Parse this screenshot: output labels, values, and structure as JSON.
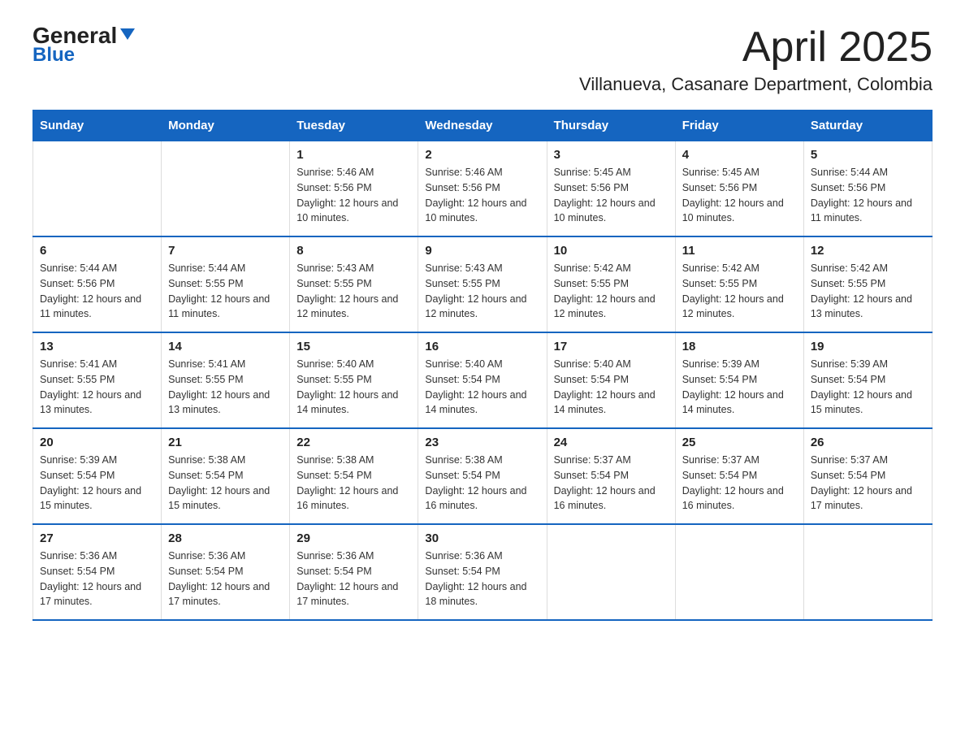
{
  "logo": {
    "general": "General",
    "blue": "Blue"
  },
  "header": {
    "title": "April 2025",
    "subtitle": "Villanueva, Casanare Department, Colombia"
  },
  "weekdays": [
    "Sunday",
    "Monday",
    "Tuesday",
    "Wednesday",
    "Thursday",
    "Friday",
    "Saturday"
  ],
  "weeks": [
    [
      {
        "day": "",
        "info": ""
      },
      {
        "day": "",
        "info": ""
      },
      {
        "day": "1",
        "info": "Sunrise: 5:46 AM\nSunset: 5:56 PM\nDaylight: 12 hours and 10 minutes."
      },
      {
        "day": "2",
        "info": "Sunrise: 5:46 AM\nSunset: 5:56 PM\nDaylight: 12 hours and 10 minutes."
      },
      {
        "day": "3",
        "info": "Sunrise: 5:45 AM\nSunset: 5:56 PM\nDaylight: 12 hours and 10 minutes."
      },
      {
        "day": "4",
        "info": "Sunrise: 5:45 AM\nSunset: 5:56 PM\nDaylight: 12 hours and 10 minutes."
      },
      {
        "day": "5",
        "info": "Sunrise: 5:44 AM\nSunset: 5:56 PM\nDaylight: 12 hours and 11 minutes."
      }
    ],
    [
      {
        "day": "6",
        "info": "Sunrise: 5:44 AM\nSunset: 5:56 PM\nDaylight: 12 hours and 11 minutes."
      },
      {
        "day": "7",
        "info": "Sunrise: 5:44 AM\nSunset: 5:55 PM\nDaylight: 12 hours and 11 minutes."
      },
      {
        "day": "8",
        "info": "Sunrise: 5:43 AM\nSunset: 5:55 PM\nDaylight: 12 hours and 12 minutes."
      },
      {
        "day": "9",
        "info": "Sunrise: 5:43 AM\nSunset: 5:55 PM\nDaylight: 12 hours and 12 minutes."
      },
      {
        "day": "10",
        "info": "Sunrise: 5:42 AM\nSunset: 5:55 PM\nDaylight: 12 hours and 12 minutes."
      },
      {
        "day": "11",
        "info": "Sunrise: 5:42 AM\nSunset: 5:55 PM\nDaylight: 12 hours and 12 minutes."
      },
      {
        "day": "12",
        "info": "Sunrise: 5:42 AM\nSunset: 5:55 PM\nDaylight: 12 hours and 13 minutes."
      }
    ],
    [
      {
        "day": "13",
        "info": "Sunrise: 5:41 AM\nSunset: 5:55 PM\nDaylight: 12 hours and 13 minutes."
      },
      {
        "day": "14",
        "info": "Sunrise: 5:41 AM\nSunset: 5:55 PM\nDaylight: 12 hours and 13 minutes."
      },
      {
        "day": "15",
        "info": "Sunrise: 5:40 AM\nSunset: 5:55 PM\nDaylight: 12 hours and 14 minutes."
      },
      {
        "day": "16",
        "info": "Sunrise: 5:40 AM\nSunset: 5:54 PM\nDaylight: 12 hours and 14 minutes."
      },
      {
        "day": "17",
        "info": "Sunrise: 5:40 AM\nSunset: 5:54 PM\nDaylight: 12 hours and 14 minutes."
      },
      {
        "day": "18",
        "info": "Sunrise: 5:39 AM\nSunset: 5:54 PM\nDaylight: 12 hours and 14 minutes."
      },
      {
        "day": "19",
        "info": "Sunrise: 5:39 AM\nSunset: 5:54 PM\nDaylight: 12 hours and 15 minutes."
      }
    ],
    [
      {
        "day": "20",
        "info": "Sunrise: 5:39 AM\nSunset: 5:54 PM\nDaylight: 12 hours and 15 minutes."
      },
      {
        "day": "21",
        "info": "Sunrise: 5:38 AM\nSunset: 5:54 PM\nDaylight: 12 hours and 15 minutes."
      },
      {
        "day": "22",
        "info": "Sunrise: 5:38 AM\nSunset: 5:54 PM\nDaylight: 12 hours and 16 minutes."
      },
      {
        "day": "23",
        "info": "Sunrise: 5:38 AM\nSunset: 5:54 PM\nDaylight: 12 hours and 16 minutes."
      },
      {
        "day": "24",
        "info": "Sunrise: 5:37 AM\nSunset: 5:54 PM\nDaylight: 12 hours and 16 minutes."
      },
      {
        "day": "25",
        "info": "Sunrise: 5:37 AM\nSunset: 5:54 PM\nDaylight: 12 hours and 16 minutes."
      },
      {
        "day": "26",
        "info": "Sunrise: 5:37 AM\nSunset: 5:54 PM\nDaylight: 12 hours and 17 minutes."
      }
    ],
    [
      {
        "day": "27",
        "info": "Sunrise: 5:36 AM\nSunset: 5:54 PM\nDaylight: 12 hours and 17 minutes."
      },
      {
        "day": "28",
        "info": "Sunrise: 5:36 AM\nSunset: 5:54 PM\nDaylight: 12 hours and 17 minutes."
      },
      {
        "day": "29",
        "info": "Sunrise: 5:36 AM\nSunset: 5:54 PM\nDaylight: 12 hours and 17 minutes."
      },
      {
        "day": "30",
        "info": "Sunrise: 5:36 AM\nSunset: 5:54 PM\nDaylight: 12 hours and 18 minutes."
      },
      {
        "day": "",
        "info": ""
      },
      {
        "day": "",
        "info": ""
      },
      {
        "day": "",
        "info": ""
      }
    ]
  ]
}
